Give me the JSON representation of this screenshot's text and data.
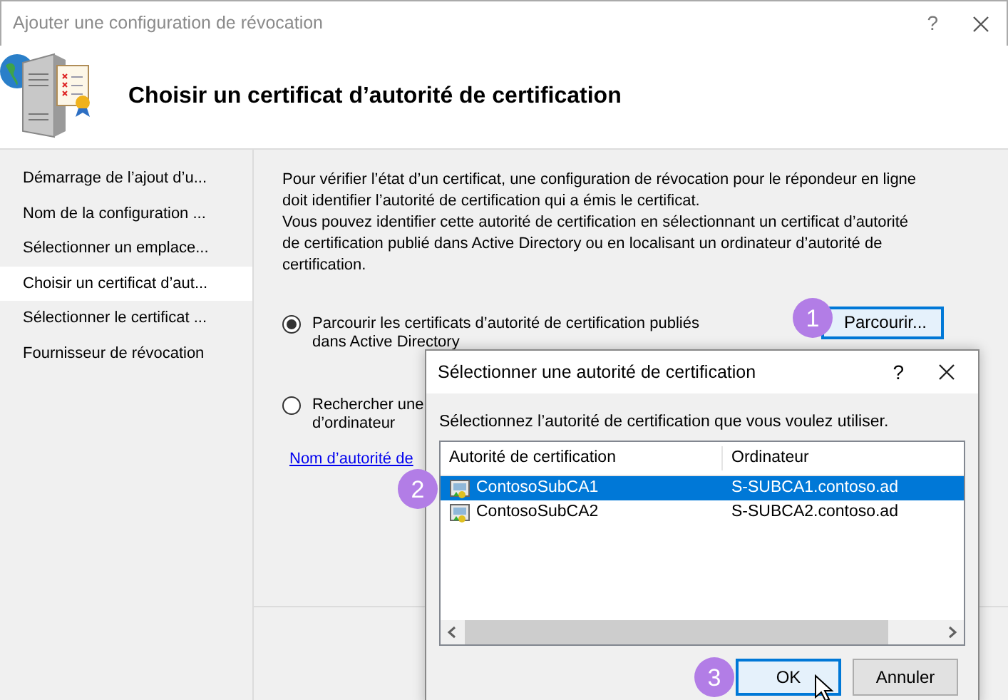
{
  "window": {
    "title": "Ajouter une configuration de révocation",
    "help": "?"
  },
  "header": {
    "title": "Choisir un certificat d’autorité de certification"
  },
  "steps": [
    {
      "label": "Démarrage de l’ajout d’u...",
      "selected": false
    },
    {
      "label": "Nom de la configuration ...",
      "selected": false
    },
    {
      "label": "Sélectionner un emplace...",
      "selected": false
    },
    {
      "label": "Choisir un certificat d’aut...",
      "selected": true
    },
    {
      "label": "Sélectionner le certificat ...",
      "selected": false
    },
    {
      "label": "Fournisseur de révocation",
      "selected": false
    }
  ],
  "description": [
    "Pour vérifier l’état d’un certificat, une configuration de révocation pour le répondeur en ligne doit identifier l’autorité de certification qui a émis le certificat.",
    "Vous pouvez identifier cette autorité de certification en sélectionnant un certificat d’autorité de certification publié dans Active Directory ou en localisant un ordinateur d’autorité de certification."
  ],
  "options": [
    {
      "label": "Parcourir les certificats d’autorité de certification publiés dans Active Directory",
      "selected": true,
      "button": "Parcourir...",
      "callout": "1"
    },
    {
      "label": "Rechercher une\nd’ordinateur",
      "selected": false
    }
  ],
  "link": "Nom d’autorité de",
  "dialog": {
    "title": "Sélectionner une autorité de certification",
    "help": "?",
    "instruction": "Sélectionnez l’autorité de certification que vous voulez utiliser.",
    "columns": [
      "Autorité de certification",
      "Ordinateur"
    ],
    "rows": [
      {
        "name": "ContosoSubCA1",
        "computer": "S-SUBCA1.contoso.ad",
        "selected": true,
        "callout": "2"
      },
      {
        "name": "ContosoSubCA2",
        "computer": "S-SUBCA2.contoso.ad",
        "selected": false
      }
    ],
    "buttons": [
      {
        "label": "OK",
        "focused": true,
        "callout": "3"
      },
      {
        "label": "Annuler",
        "focused": false
      }
    ]
  }
}
